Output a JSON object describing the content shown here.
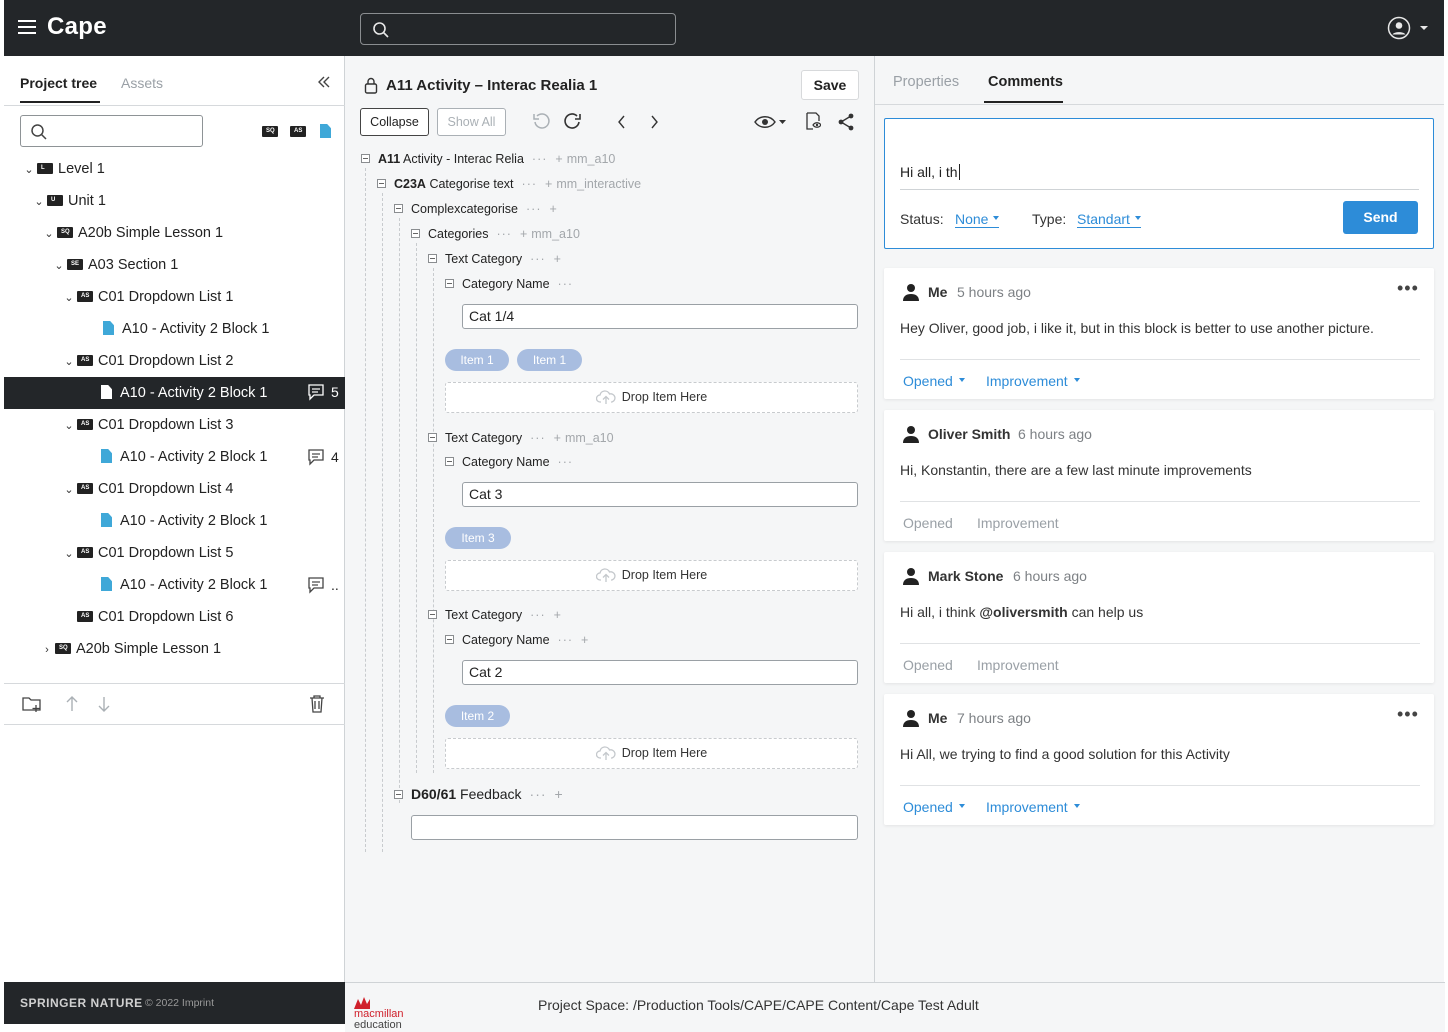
{
  "app": {
    "title": "Cape"
  },
  "left": {
    "tabs": {
      "tree": "Project tree",
      "assets": "Assets"
    },
    "tree": [
      {
        "label": "Level 1",
        "type": "folder",
        "code": "L"
      },
      {
        "label": "Unit 1",
        "type": "folder",
        "code": "U"
      },
      {
        "label": "A20b Simple Lesson 1",
        "type": "folder",
        "code": "SQ"
      },
      {
        "label": "A03 Section 1",
        "type": "folder",
        "code": "SE"
      },
      {
        "label": "C01 Dropdown List 1",
        "type": "folder",
        "code": "AS"
      },
      {
        "label": "A10 - Activity 2 Block 1",
        "type": "doc"
      },
      {
        "label": "C01 Dropdown List 2",
        "type": "folder",
        "code": "AS"
      },
      {
        "label": "A10 - Activity 2 Block 1",
        "type": "doc",
        "selected": true,
        "comments": "5"
      },
      {
        "label": "C01 Dropdown List 3",
        "type": "folder",
        "code": "AS"
      },
      {
        "label": "A10 - Activity 2 Block 1",
        "type": "doc",
        "comments": "4"
      },
      {
        "label": "C01 Dropdown List 4",
        "type": "folder",
        "code": "AS"
      },
      {
        "label": "A10 - Activity 2 Block 1",
        "type": "doc"
      },
      {
        "label": "C01 Dropdown List 5",
        "type": "folder",
        "code": "AS"
      },
      {
        "label": "A10 - Activity 2 Block 1",
        "type": "doc",
        "comments": ".."
      },
      {
        "label": "C01 Dropdown List 6",
        "type": "folder",
        "code": "AS"
      },
      {
        "label": "A20b Simple Lesson 1",
        "type": "folder",
        "code": "SQ"
      }
    ],
    "footer": {
      "brand": "SPRINGER NATURE",
      "copyright": "© 2022 Imprint"
    }
  },
  "editor": {
    "title": "A11 Activity – Interac Realia 1",
    "save": "Save",
    "collapse": "Collapse",
    "show_all": "Show All",
    "structure": {
      "root": {
        "code": "A11",
        "label": "Activity - Interac Relia",
        "tag": "mm_a10"
      },
      "c23a": {
        "code": "C23A",
        "label": "Categorise text",
        "tag": "mm_interactive"
      },
      "complex": "Complexcategorise",
      "categories": {
        "label": "Categories",
        "tag": "mm_a10"
      },
      "text_category": "Text Category",
      "category_name": "Category Name",
      "tag_a10": "mm_a10",
      "cats": [
        "Cat 1/4",
        "Cat 3",
        "Cat 2"
      ],
      "items": [
        "Item 1",
        "Item 1",
        "Item 3",
        "Item 2"
      ],
      "drop": "Drop Item Here",
      "feedback": {
        "code": "D60/61",
        "label": "Feedback"
      }
    }
  },
  "comments": {
    "tabs": {
      "properties": "Properties",
      "comments": "Comments"
    },
    "composer": {
      "text": "Hi all, i th",
      "status_label": "Status:",
      "status_value": "None",
      "type_label": "Type:",
      "type_value": "Standart",
      "send": "Send"
    },
    "list": [
      {
        "author": "Me",
        "time": "5 hours ago",
        "body": "Hey Oliver, good job, i like it, but in this block is better to use another picture.",
        "status": "Opened",
        "type": "Improvement",
        "active": true
      },
      {
        "author": "Oliver Smith",
        "time": "6 hours ago",
        "body": "Hi, Konstantin, there are a few last minute improvements",
        "status": "Opened",
        "type": "Improvement",
        "active": false
      },
      {
        "author": "Mark Stone",
        "time": "6 hours ago",
        "body_pre": "Hi all, i think ",
        "mention": "@oliversmith",
        "body_post": " can help us",
        "status": "Opened",
        "type": "Improvement",
        "active": false
      },
      {
        "author": "Me",
        "time": "7 hours ago",
        "body": "Hi All, we trying to find a good solution for this Activity",
        "status": "Opened",
        "type": "Improvement",
        "active": true
      }
    ]
  },
  "footer": {
    "logo_top": "macmillan",
    "logo_bottom": "education",
    "project_space": "Project Space: /Production Tools/CAPE/CAPE Content/Cape Test Adult"
  },
  "colors": {
    "topbar": "#232629",
    "accent": "#2d8cd8",
    "chip": "#a8bde0",
    "doc_icon": "#3fa8d8"
  }
}
